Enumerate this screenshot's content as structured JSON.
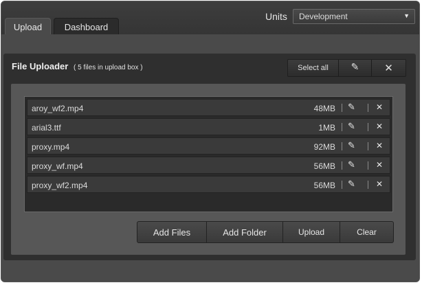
{
  "header": {
    "units_label": "Units",
    "units_selected": "Development",
    "tabs": [
      {
        "label": "Upload",
        "active": true
      },
      {
        "label": "Dashboard",
        "active": false
      }
    ]
  },
  "uploader": {
    "title": "File Uploader",
    "subtitle": "( 5 files in upload box )",
    "toolbar": {
      "select_all": "Select all"
    },
    "files": [
      {
        "name": "aroy_wf2.mp4",
        "size": "48MB"
      },
      {
        "name": "arial3.ttf",
        "size": "1MB"
      },
      {
        "name": "proxy.mp4",
        "size": "92MB"
      },
      {
        "name": "proxy_wf.mp4",
        "size": "56MB"
      },
      {
        "name": "proxy_wf2.mp4",
        "size": "56MB"
      }
    ],
    "buttons": {
      "add_files": "Add Files",
      "add_folder": "Add Folder",
      "upload": "Upload",
      "clear": "Clear"
    }
  },
  "icons": {
    "select_chevron": "chevron-down-icon",
    "edit": "pencil-icon",
    "remove": "close-icon"
  },
  "colors": {
    "window_bg": "#3a3a3a",
    "panel_bg": "#2f2f2f",
    "row_bg": "#3a3a3a",
    "text": "#e0e0e0"
  }
}
